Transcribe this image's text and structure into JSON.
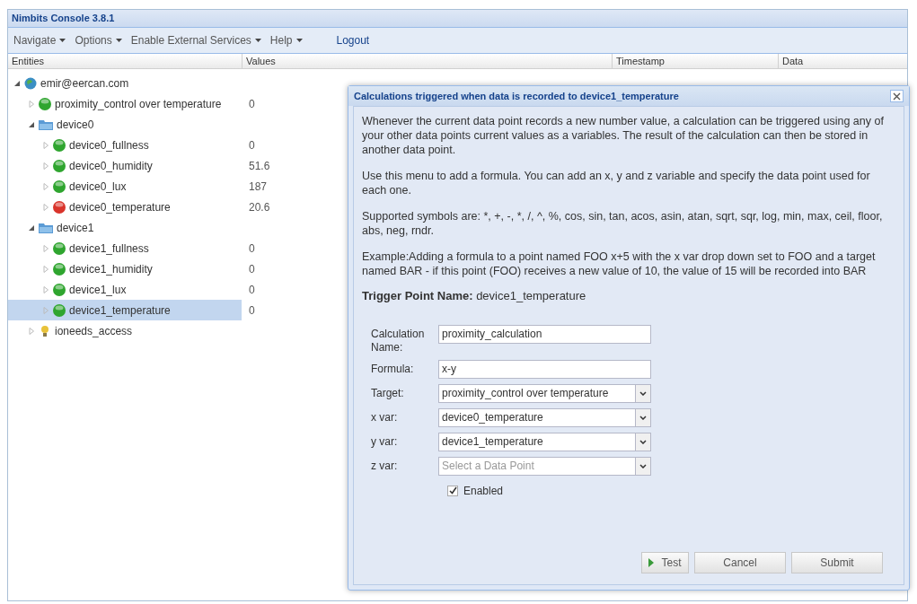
{
  "window": {
    "title": "Nimbits Console 3.8.1"
  },
  "menu": [
    {
      "label": "Navigate",
      "dropdown": true
    },
    {
      "label": "Options",
      "dropdown": true
    },
    {
      "label": "Enable External Services",
      "dropdown": true
    },
    {
      "label": "Help",
      "dropdown": true
    },
    {
      "label": "Logout",
      "dropdown": false
    }
  ],
  "table": {
    "columns": [
      "Entities",
      "Values",
      "Timestamp",
      "Data"
    ],
    "tree": [
      {
        "label": "emir@eercan.com",
        "kind": "user",
        "expanded": true,
        "selected": false,
        "children": [
          {
            "label": "proximity_control over temperature",
            "kind": "point",
            "color": "#2fa52f",
            "value": "0",
            "expanded": false,
            "selected": false
          },
          {
            "label": "device0",
            "kind": "category",
            "expanded": true,
            "selected": false,
            "children": [
              {
                "label": "device0_fullness",
                "kind": "point",
                "color": "#2fa52f",
                "value": "0",
                "expanded": false,
                "selected": false
              },
              {
                "label": "device0_humidity",
                "kind": "point",
                "color": "#2fa52f",
                "value": "51.6",
                "expanded": false,
                "selected": false
              },
              {
                "label": "device0_lux",
                "kind": "point",
                "color": "#2fa52f",
                "value": "187",
                "expanded": false,
                "selected": false
              },
              {
                "label": "device0_temperature",
                "kind": "point",
                "color": "#d9342b",
                "value": "20.6",
                "expanded": false,
                "selected": false
              }
            ]
          },
          {
            "label": "device1",
            "kind": "category",
            "expanded": true,
            "selected": false,
            "children": [
              {
                "label": "device1_fullness",
                "kind": "point",
                "color": "#2fa52f",
                "value": "0",
                "expanded": false,
                "selected": false
              },
              {
                "label": "device1_humidity",
                "kind": "point",
                "color": "#2fa52f",
                "value": "0",
                "expanded": false,
                "selected": false
              },
              {
                "label": "device1_lux",
                "kind": "point",
                "color": "#2fa52f",
                "value": "0",
                "expanded": false,
                "selected": false
              },
              {
                "label": "device1_temperature",
                "kind": "point",
                "color": "#2fa52f",
                "value": "0",
                "expanded": false,
                "selected": true
              }
            ]
          },
          {
            "label": "ioneeds_access",
            "kind": "key",
            "expanded": false,
            "selected": false
          }
        ]
      }
    ]
  },
  "dialog": {
    "title": "Calculations triggered when data is recorded to device1_temperature",
    "paragraphs": [
      "Whenever the current data point records a new number value, a calculation can be triggered using any of your other data points current values as a variables. The result of the calculation can then be stored in another data point.",
      "Use this menu to add a formula. You can add an x, y and z variable and specify the data point used for each one.",
      "Supported symbols are: *, +, -, *, /, ^, %, cos, sin, tan, acos, asin, atan, sqrt, sqr, log, min, max, ceil, floor, abs, neg, rndr.",
      "Example:Adding a formula to a point named FOO x+5 with the x var drop down set to FOO and a target named BAR - if this point (FOO) receives a new value of 10, the value of 15 will be recorded into BAR"
    ],
    "trigger": "**Trigger Point Name:** device1_temperature",
    "fields": [
      {
        "label": "Calculation Name:",
        "kind": "text",
        "value": "proximity_calculation"
      },
      {
        "label": "Formula:",
        "kind": "text",
        "value": "x-y"
      },
      {
        "label": "Target:",
        "kind": "select",
        "value": "proximity_control over temperature"
      },
      {
        "label": "x var:",
        "kind": "select",
        "value": "device0_temperature"
      },
      {
        "label": "y var:",
        "kind": "select",
        "value": "device1_temperature"
      },
      {
        "label": "z var:",
        "kind": "select",
        "placeholder": "Select a Data Point"
      }
    ],
    "enabled": {
      "label": "Enabled",
      "checked": true
    },
    "buttons": [
      {
        "label": "Test",
        "kind": "run"
      },
      {
        "label": "Cancel",
        "kind": "plain"
      },
      {
        "label": "Submit",
        "kind": "plain"
      }
    ]
  }
}
